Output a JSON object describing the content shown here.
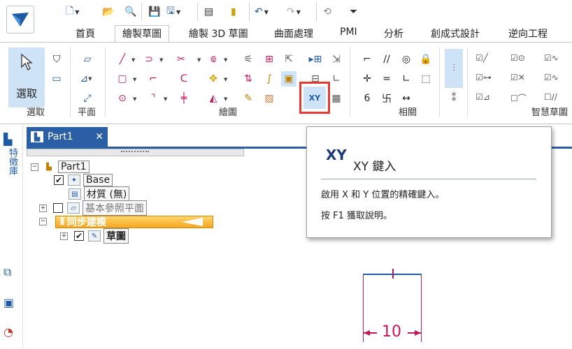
{
  "quick_access": {
    "icons": [
      "new-icon",
      "open-icon",
      "save-icon",
      "print-icon",
      "properties-icon",
      "attach-icon",
      "undo-icon",
      "redo-icon",
      "customize-icon"
    ]
  },
  "tabs": [
    {
      "label": "首頁",
      "active": false
    },
    {
      "label": "繪製草圖",
      "active": true
    },
    {
      "label": "繪製 3D 草圖",
      "active": false
    },
    {
      "label": "曲面處理",
      "active": false
    },
    {
      "label": "PMI",
      "active": false
    },
    {
      "label": "分析",
      "active": false
    },
    {
      "label": "創成式設計",
      "active": false
    },
    {
      "label": "逆向工程",
      "active": false
    }
  ],
  "ribbon": {
    "select_label": "選取",
    "groups": {
      "select": "選取",
      "plane": "平面",
      "draw": "繪圖",
      "relate": "相關",
      "smart_sketch": "智慧草圖"
    },
    "xy_button_label": "XY"
  },
  "document": {
    "tab_title": "Part1",
    "close_glyph": "✕"
  },
  "tree": {
    "root": "Part1",
    "base": "Base",
    "material": "材質 (無)",
    "ref_planes": "基本參照平面",
    "sync_model": "同步建模",
    "sketch": "草圖"
  },
  "left_strip": {
    "feature_lib_label": "特徵庫"
  },
  "tooltip": {
    "icon_text": "XY",
    "title": "XY 鍵入",
    "description": "啟用 X 和 Y 位置的精確鍵入。",
    "help": "按 F1 獲取說明。"
  },
  "sketch": {
    "dimension_value": "10"
  },
  "colors": {
    "accent_blue": "#2a5fa5",
    "sketch_magenta": "#c2185b",
    "highlight": "#cfe3f7",
    "callout_red": "#e53935"
  }
}
